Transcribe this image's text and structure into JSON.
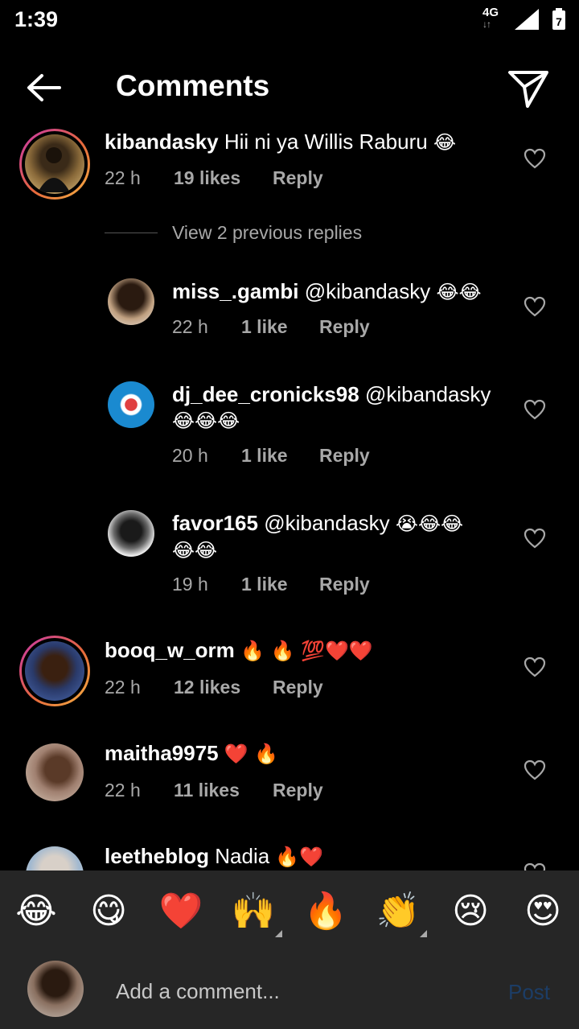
{
  "status_bar": {
    "time": "1:39",
    "network": "4G",
    "network_arrows": "↓↑",
    "battery_level": "7"
  },
  "header": {
    "title": "Comments"
  },
  "comments": [
    {
      "username": "kibandasky",
      "text": "Hii ni ya Willis Raburu",
      "emojis": "😂",
      "time": "22 h",
      "likes": "19 likes",
      "reply_label": "Reply",
      "view_replies_label": "View 2 previous replies",
      "replies": [
        {
          "username": "miss_.gambi",
          "text": "@kibandasky",
          "emojis": "😂😂",
          "time": "22 h",
          "likes": "1 like",
          "reply_label": "Reply"
        },
        {
          "username": "dj_dee_cronicks98",
          "text": "@kibandasky",
          "emojis": "😂😂😂",
          "time": "20 h",
          "likes": "1 like",
          "reply_label": "Reply"
        },
        {
          "username": "favor165",
          "text": "@kibandasky",
          "emojis": "😭😂😂",
          "emojis_line2": "😂😂",
          "time": "19 h",
          "likes": "1 like",
          "reply_label": "Reply"
        }
      ]
    },
    {
      "username": "booq_w_orm",
      "text": "",
      "emojis": "🔥 🔥 💯❤️❤️",
      "time": "22 h",
      "likes": "12 likes",
      "reply_label": "Reply"
    },
    {
      "username": "maitha9975",
      "text": "",
      "emojis": "❤️ 🔥",
      "time": "22 h",
      "likes": "11 likes",
      "reply_label": "Reply"
    },
    {
      "username": "leetheblog",
      "text": "Nadia",
      "emojis": "🔥❤️"
    }
  ],
  "emoji_bar": [
    "😂",
    "😋",
    "❤️",
    "🙌",
    "🔥",
    "👏",
    "😢",
    "😍"
  ],
  "composer": {
    "placeholder": "Add a comment...",
    "post_label": "Post"
  },
  "colors": {
    "background": "#000000",
    "secondary_text": "#a8a8a8",
    "bar_background": "#262626",
    "post_disabled": "#1c3d66",
    "heart_red": "#e0201f"
  }
}
